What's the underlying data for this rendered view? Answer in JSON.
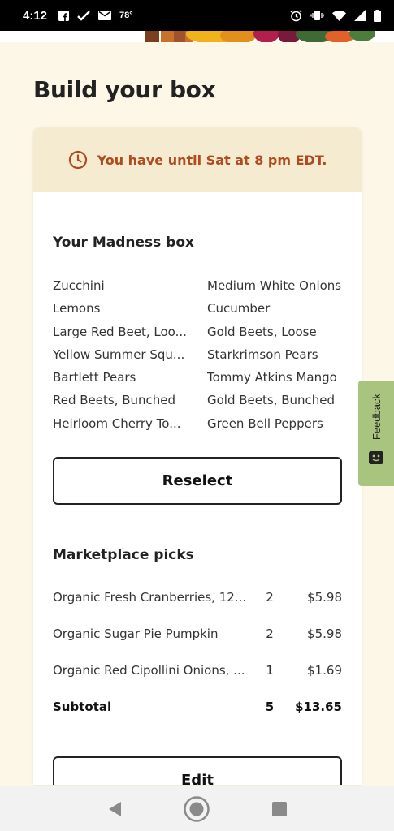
{
  "status_bar": {
    "time": "4:12",
    "temperature": "78°",
    "icons": [
      "facebook-icon",
      "check-icon",
      "mail-icon",
      "alarm-icon",
      "vibrate-icon",
      "wifi-icon",
      "signal-icon",
      "battery-icon"
    ]
  },
  "page": {
    "title": "Build your box"
  },
  "deadline": {
    "text": "You have until Sat at 8 pm EDT.",
    "icon": "clock-icon",
    "color": "#b04a1f"
  },
  "box": {
    "title": "Your Madness box",
    "items": [
      [
        "Zucchini",
        "Medium White Onions"
      ],
      [
        "Lemons",
        "Cucumber"
      ],
      [
        "Large Red Beet, Loo...",
        "Gold Beets, Loose"
      ],
      [
        "Yellow Summer Squ...",
        "Starkrimson Pears"
      ],
      [
        "Bartlett Pears",
        "Tommy Atkins Mango"
      ],
      [
        "Red Beets, Bunched",
        "Gold Beets, Bunched"
      ],
      [
        "Heirloom Cherry To...",
        "Green Bell Peppers"
      ]
    ],
    "reselect_label": "Reselect"
  },
  "marketplace": {
    "title": "Marketplace picks",
    "picks": [
      {
        "name": "Organic Fresh Cranberries, 12...",
        "qty": "2",
        "price": "$5.98"
      },
      {
        "name": "Organic Sugar Pie Pumpkin",
        "qty": "2",
        "price": "$5.98"
      },
      {
        "name": "Organic Red Cipollini Onions, ...",
        "qty": "1",
        "price": "$1.69"
      }
    ],
    "subtotal": {
      "label": "Subtotal",
      "qty": "5",
      "price": "$13.65"
    },
    "edit_label": "Edit"
  },
  "feedback": {
    "label": "Feedback",
    "color": "#a9c47f"
  },
  "nav": {
    "icons": [
      "back-icon",
      "home-icon",
      "recents-icon"
    ]
  }
}
